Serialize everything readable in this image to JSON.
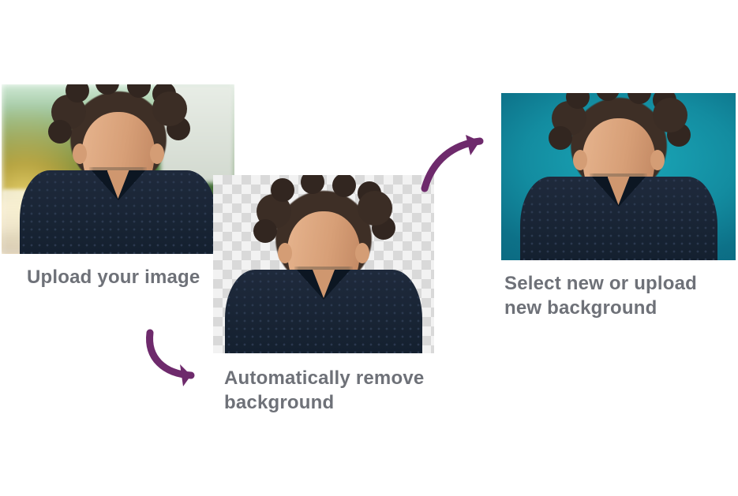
{
  "steps": {
    "upload": {
      "caption": "Upload your image"
    },
    "remove": {
      "caption": "Automatically remove background"
    },
    "select": {
      "caption": "Select new or upload new background"
    }
  },
  "colors": {
    "arrow": "#6e2a6c",
    "text": "#6e7178",
    "teal": "#138ca0"
  }
}
